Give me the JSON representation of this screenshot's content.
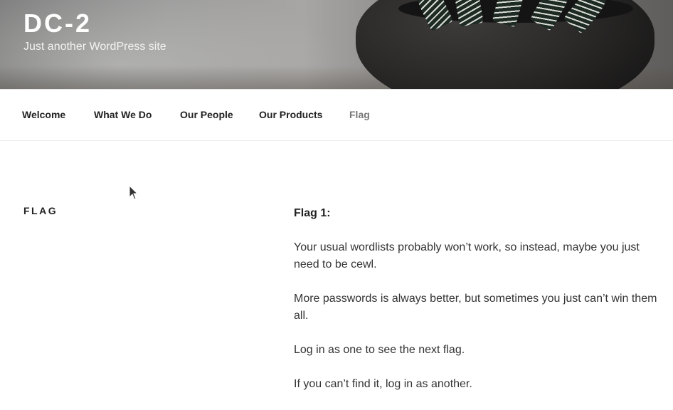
{
  "site": {
    "title": "DC-2",
    "description": "Just another WordPress site"
  },
  "nav": {
    "items": [
      {
        "label": "Welcome"
      },
      {
        "label": "What We Do"
      },
      {
        "label": "Our People"
      },
      {
        "label": "Our Products"
      },
      {
        "label": "Flag",
        "current": true
      }
    ]
  },
  "page": {
    "title": "Flag",
    "heading": "Flag 1:",
    "paragraphs": [
      "Your usual wordlists probably won’t work, so instead, maybe you just need to be cewl.",
      "More passwords is always better, but sometimes you just can’t win them all.",
      "Log in as one to see the next flag.",
      "If you can’t find it, log in as another."
    ]
  },
  "colors": {
    "title": "#ffffff",
    "nav_text": "#222222",
    "nav_current": "#767676",
    "body_text": "#333333"
  },
  "icons": {
    "cursor": "mouse-pointer-icon"
  }
}
